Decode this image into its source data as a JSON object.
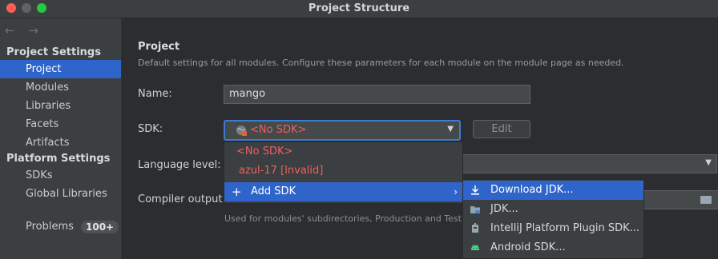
{
  "window": {
    "title": "Project Structure"
  },
  "sidebar": {
    "nav_arrows": "← →",
    "sections": [
      {
        "title": "Project Settings",
        "items": [
          "Project",
          "Modules",
          "Libraries",
          "Facets",
          "Artifacts"
        ]
      },
      {
        "title": "Platform Settings",
        "items": [
          "SDKs",
          "Global Libraries"
        ]
      }
    ],
    "problems": {
      "label": "Problems",
      "badge": "100+"
    }
  },
  "main": {
    "heading": "Project",
    "description": "Default settings for all modules. Configure these parameters for each module on the module page as needed.",
    "name_label": "Name:",
    "name_value": "mango",
    "sdk_label": "SDK:",
    "sdk_value": "<No SDK>",
    "edit_button": "Edit",
    "language_label": "Language level:",
    "compiler_label": "Compiler output:",
    "compiler_hint": "Used for modules' subdirectories, Production and Test di"
  },
  "sdk_dropdown": {
    "items": [
      "<No SDK>",
      "azul-17 [Invalid]"
    ],
    "add_sdk": {
      "label": "Add SDK",
      "icon": "plus-icon"
    }
  },
  "add_sdk_submenu": {
    "items": [
      {
        "label": "Download JDK...",
        "icon": "download-icon"
      },
      {
        "label": "JDK...",
        "icon": "folder-icon"
      },
      {
        "label": "IntelliJ Platform Plugin SDK...",
        "icon": "plugin-icon"
      },
      {
        "label": "Android SDK...",
        "icon": "android-icon"
      }
    ]
  },
  "colors": {
    "accent": "#2f65ca",
    "error": "#ef5f5f",
    "background": "#2b2d30",
    "panel": "#3c3f41"
  }
}
